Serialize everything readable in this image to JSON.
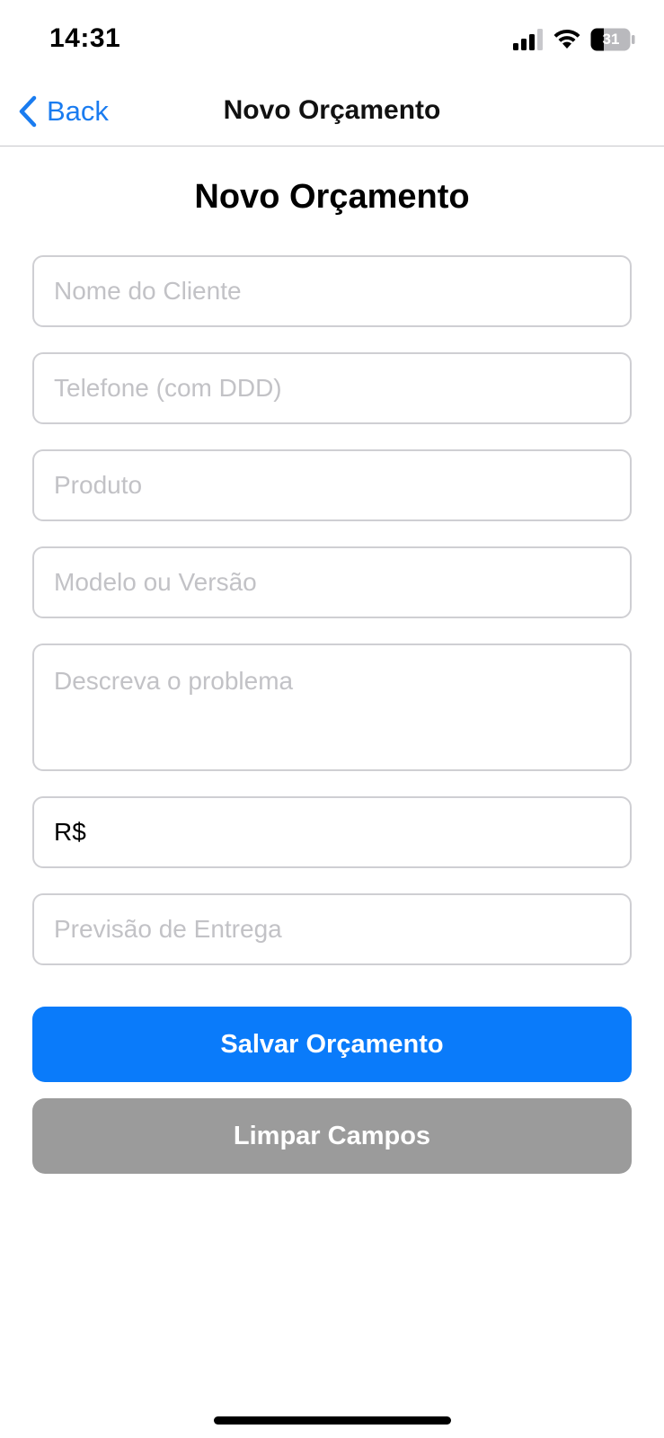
{
  "status_bar": {
    "time": "14:31",
    "battery": "31",
    "icons": [
      "signal-icon",
      "wifi-icon",
      "battery-icon"
    ]
  },
  "nav": {
    "back_label": "Back",
    "title": "Novo Orçamento"
  },
  "form": {
    "title": "Novo Orçamento",
    "fields": {
      "client_name": {
        "placeholder": "Nome do Cliente",
        "value": ""
      },
      "phone": {
        "placeholder": "Telefone (com DDD)",
        "value": ""
      },
      "product": {
        "placeholder": "Produto",
        "value": ""
      },
      "model": {
        "placeholder": "Modelo ou Versão",
        "value": ""
      },
      "problem": {
        "placeholder": "Descreva o problema",
        "value": ""
      },
      "price": {
        "value": "R$"
      },
      "delivery": {
        "placeholder": "Previsão de Entrega",
        "value": ""
      }
    },
    "save_label": "Salvar Orçamento",
    "clear_label": "Limpar Campos"
  },
  "colors": {
    "accent": "#0a7bfa",
    "secondary_button": "#9b9b9b",
    "placeholder": "#c2c2c6",
    "border": "#cfcfd3"
  }
}
